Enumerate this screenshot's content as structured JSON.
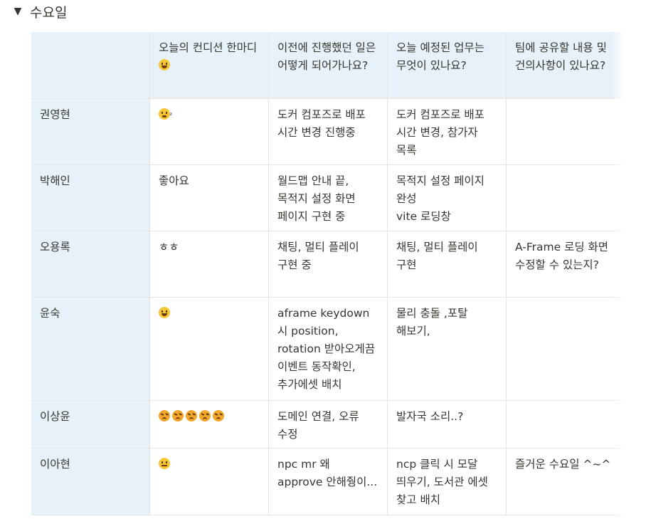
{
  "toggle": {
    "arrow_icon": "triangle-down-icon",
    "title": "수요일"
  },
  "table": {
    "headers": [
      "",
      "오늘의 컨디션 한마디",
      "이전에 진행했던 일은 어떻게 되어가나요?",
      "오늘 예정된 업무는 무엇이 있나요?",
      "팀에 공유할 내용 및 건의사항이 있나요?"
    ],
    "header_emoji": "grinning-face-icon",
    "rows": [
      {
        "name": "권영현",
        "condition_text": "",
        "condition_emoji": [
          "sleeping-face-icon"
        ],
        "progress": "도커 컴포즈로 배포 시간 변경 진행중",
        "today": "도커 컴포즈로 배포 시간 변경, 참가자 목록",
        "share": ""
      },
      {
        "name": "박해인",
        "condition_text": "좋아요",
        "condition_emoji": [],
        "progress": "월드맵 안내 끝, 목적지 설정 화면 페이지 구현 중",
        "today": "목적지 설정 페이지 완성\nvite 로딩창",
        "share": ""
      },
      {
        "name": "오용록",
        "condition_text": "ㅎㅎ",
        "condition_emoji": [],
        "progress": "채팅, 멀티 플레이 구현 중",
        "today": "채팅, 멀티 플레이 구현",
        "share": "A-Frame 로딩 화면 수정할 수 있는지?"
      },
      {
        "name": "윤숙",
        "condition_text": "",
        "condition_emoji": [
          "grinning-face-icon"
        ],
        "progress": "aframe keydown 시 position, rotation 받아오게끔  이벤트 동작확인, 추가에셋 배치",
        "today": "물리 충돌 ,포탈 해보기,",
        "share": ""
      },
      {
        "name": "이상윤",
        "condition_text": "",
        "condition_emoji": [
          "angry-face-icon",
          "angry-face-icon",
          "angry-face-icon",
          "angry-face-icon",
          "angry-face-icon"
        ],
        "progress": "도메인 연결, 오류 수정",
        "today": "발자국 소리..?",
        "share": ""
      },
      {
        "name": "이아현",
        "condition_text": "",
        "condition_emoji": [
          "expressionless-face-icon"
        ],
        "progress": "npc mr 왜 approve 안해줭이...",
        "today": "ncp 클릭 시 모달 띄우기, 도서관 에셋 찾고 배치",
        "share": "즐거운 수요일 ^~^"
      }
    ]
  },
  "colors": {
    "header_bg": "#e6f1f9",
    "border": "#e6e5e2",
    "text": "#37352f"
  }
}
